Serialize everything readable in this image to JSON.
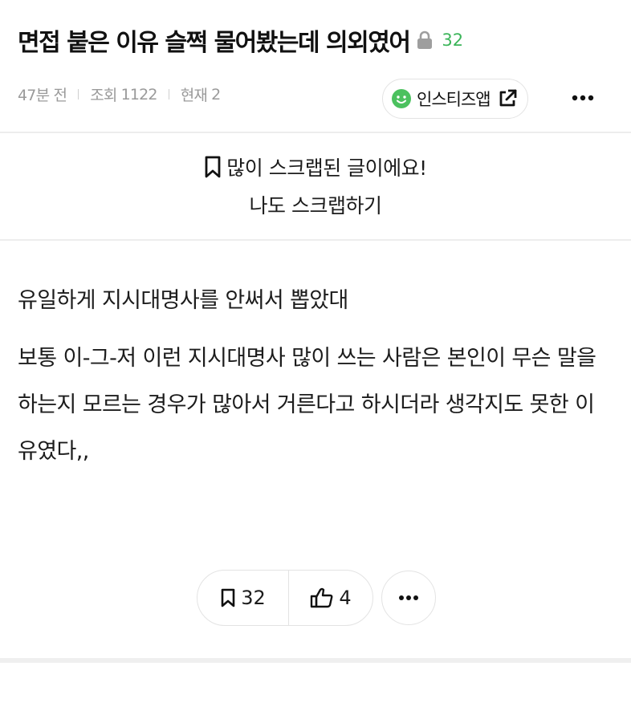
{
  "post": {
    "title": "면접 붙은 이유 슬쩍 물어봤는데 의외였어",
    "comment_count": "32",
    "time_ago": "47분 전",
    "views_label": "조회",
    "views": "1122",
    "current_label": "현재",
    "current": "2",
    "app_button_label": "인스티즈앱"
  },
  "scrap_banner": {
    "line1": "많이 스크랩된 글이에요!",
    "line2": "나도 스크랩하기"
  },
  "content": {
    "paragraphs": [
      "유일하게 지시대명사를 안써서 뽑았대",
      "보통 이-그-저 이런 지시대명사 많이 쓰는 사람은 본인이 무슨 말을 하는지 모르는 경우가 많아서 거른다고 하시더라 생각지도 못한 이유였다,,"
    ]
  },
  "actions": {
    "scrap_count": "32",
    "like_count": "4"
  },
  "icons": {
    "lock": "lock-icon",
    "smile": "smile-icon",
    "external": "external-link-icon",
    "more": "more-icon",
    "bookmark": "bookmark-icon",
    "thumbs_up": "thumbs-up-icon"
  },
  "colors": {
    "comment_count": "#3cb55a",
    "app_icon": "#4cc15f",
    "meta_text": "#9a9a9a"
  }
}
